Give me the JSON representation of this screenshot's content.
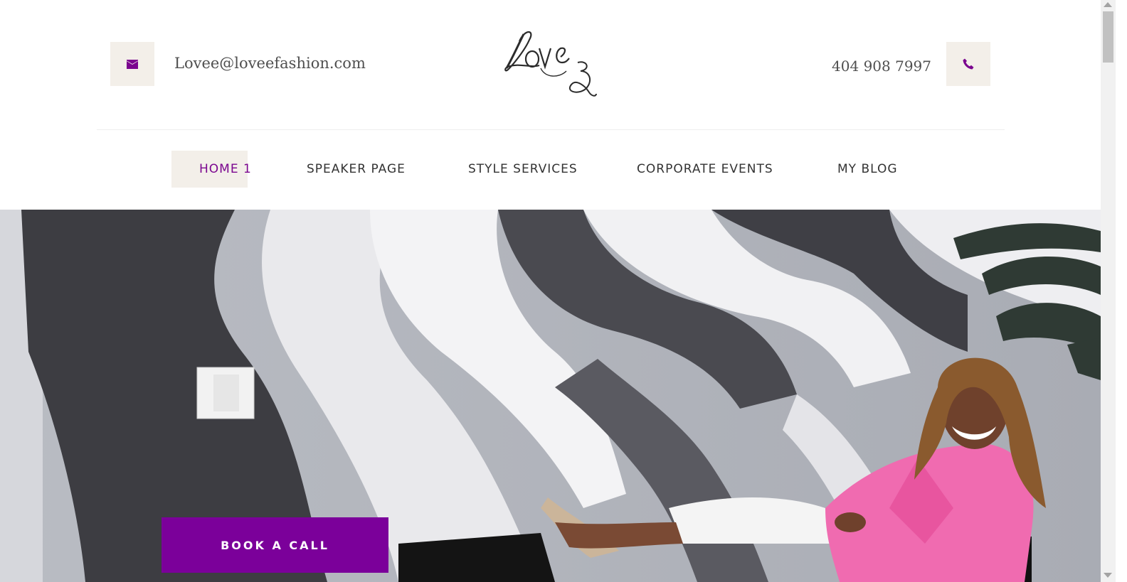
{
  "header": {
    "email": "Lovee@loveefashion.com",
    "phone": "404 908 7997",
    "logo_text": "LoveE",
    "email_icon": "envelope-icon",
    "phone_icon": "phone-icon"
  },
  "nav": {
    "items": [
      {
        "label": "HOME 1",
        "active": true
      },
      {
        "label": "SPEAKER PAGE",
        "active": false
      },
      {
        "label": "STYLE SERVICES",
        "active": false
      },
      {
        "label": "CORPORATE EVENTS",
        "active": false
      },
      {
        "label": "MY BLOG",
        "active": false
      }
    ]
  },
  "hero": {
    "cta_label": "BOOK A CALL"
  },
  "colors": {
    "accent": "#7b009a",
    "icon_purple": "#7b068f",
    "icon_box_bg": "#f3efe9",
    "text": "#333333",
    "blazer_pink": "#f06bb0"
  }
}
